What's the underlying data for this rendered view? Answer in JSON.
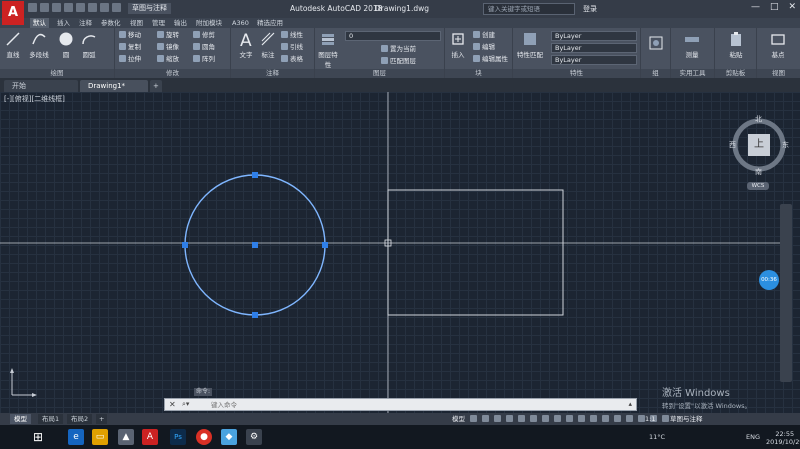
{
  "app": {
    "logo": "A",
    "workspace": "草图与注释",
    "title": "Autodesk AutoCAD 2018",
    "document": "Drawing1.dwg",
    "search_placeholder": "键入关键字或短语",
    "login": "登录"
  },
  "ribbon_tabs": [
    {
      "label": "默认"
    },
    {
      "label": "插入"
    },
    {
      "label": "注释"
    },
    {
      "label": "参数化"
    },
    {
      "label": "视图"
    },
    {
      "label": "管理"
    },
    {
      "label": "输出"
    },
    {
      "label": "附加模块"
    },
    {
      "label": "A360"
    },
    {
      "label": "精选应用"
    }
  ],
  "panels": {
    "draw": {
      "title": "绘图",
      "line": "直线",
      "polyline": "多段线",
      "circle": "圆",
      "arc": "圆弧"
    },
    "modify": {
      "title": "修改",
      "move": "移动",
      "rotate": "旋转",
      "trim": "修剪",
      "copy": "复制",
      "mirror": "镜像",
      "fillet": "圆角",
      "stretch": "拉伸",
      "scale": "缩放",
      "array": "阵列"
    },
    "annotation": {
      "title": "注释",
      "text": "文字",
      "dimension": "标注",
      "linear": "线性",
      "leader": "引线",
      "table": "表格"
    },
    "layers": {
      "title": "图层",
      "props": "图层特性",
      "layer_value": "0",
      "make_current": "置为当前",
      "match": "匹配图层"
    },
    "block": {
      "title": "块",
      "insert": "插入",
      "create": "创建",
      "edit": "编辑",
      "edit_attr": "编辑属性"
    },
    "properties": {
      "title": "特性",
      "match_props": "特性匹配",
      "color": "ByLayer",
      "linetype": "ByLayer",
      "lineweight": "ByLayer"
    },
    "groups": {
      "title": "组"
    },
    "utilities": {
      "title": "实用工具",
      "measure": "测量"
    },
    "clipboard": {
      "title": "剪贴板",
      "paste": "粘贴"
    },
    "view": {
      "title": "视图",
      "base": "基点"
    }
  },
  "file_tabs": [
    {
      "label": "开始"
    },
    {
      "label": "Drawing1*"
    }
  ],
  "viewport_label": "[-][俯视][二维线框]",
  "viewcube": {
    "north": "北",
    "south": "南",
    "east": "东",
    "west": "西",
    "face": "上",
    "wcs": "WCS"
  },
  "zoom_badge": "00:36",
  "watermark": {
    "title": "激活 Windows",
    "subtitle": "转到\"设置\"以激活 Windows。"
  },
  "command": {
    "history_label": "命令:",
    "placeholder": "键入命令"
  },
  "layout_tabs": [
    {
      "label": "模型"
    },
    {
      "label": "布局1"
    },
    {
      "label": "布局2"
    }
  ],
  "status": {
    "model": "模型",
    "scale": "1:1",
    "workspace": "草图与注释"
  },
  "taskbar": {
    "temperature": "11°C",
    "language": "ENG",
    "time": "22:55",
    "date": "2019/10/29"
  }
}
